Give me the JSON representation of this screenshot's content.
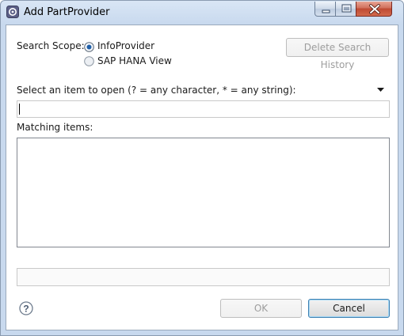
{
  "window": {
    "title": "Add PartProvider",
    "controls": [
      "minimize-icon",
      "maximize-icon",
      "close-icon"
    ]
  },
  "search_scope": {
    "label": "Search Scope:",
    "options": [
      {
        "label": "InfoProvider",
        "selected": true
      },
      {
        "label": "SAP HANA View",
        "selected": false
      }
    ]
  },
  "delete_history_label": "Delete Search History",
  "select_prompt": "Select an item to open (? = any character, * = any string):",
  "search_input": {
    "value": "",
    "placeholder": ""
  },
  "matching_items": {
    "label": "Matching items:",
    "items": []
  },
  "status_text": "",
  "footer": {
    "ok_label": "OK",
    "cancel_label": "Cancel",
    "help_icon": "question-icon"
  },
  "colors": {
    "close_button": "#c9513a",
    "default_button_border": "#3c7fb1",
    "radio_selected": "#1f5fa8"
  }
}
